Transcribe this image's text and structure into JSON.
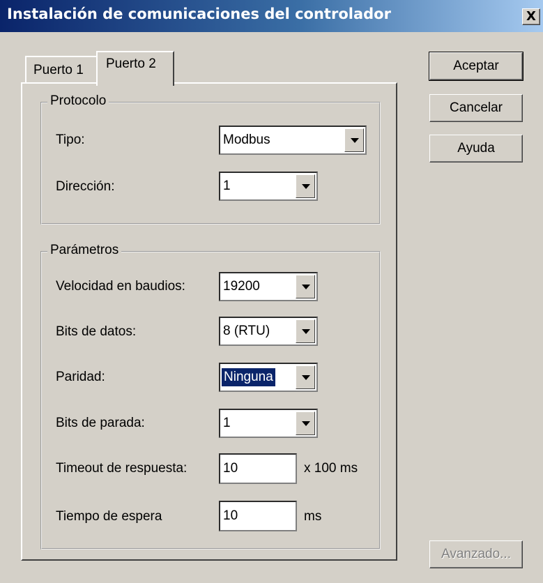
{
  "window": {
    "title": "Instalación de comunicaciones del controlador",
    "close_label": "X"
  },
  "tabs": [
    {
      "label": "Puerto 1",
      "active": false
    },
    {
      "label": "Puerto 2",
      "active": true
    }
  ],
  "protocol": {
    "legend": "Protocolo",
    "tipo": {
      "label": "Tipo:",
      "value": "Modbus"
    },
    "direccion": {
      "label": "Dirección:",
      "value": "1"
    }
  },
  "params": {
    "legend": "Parámetros",
    "baud": {
      "label": "Velocidad en baudios:",
      "value": "19200"
    },
    "data_bits": {
      "label": "Bits de datos:",
      "value": "8 (RTU)"
    },
    "parity": {
      "label": "Paridad:",
      "value": "Ninguna"
    },
    "stop_bits": {
      "label": "Bits de parada:",
      "value": "1"
    },
    "timeout": {
      "label": "Timeout de respuesta:",
      "value": "10",
      "unit": "x 100 ms"
    },
    "wait": {
      "label": "Tiempo de espera",
      "value": "10",
      "unit": "ms"
    }
  },
  "buttons": {
    "accept": "Aceptar",
    "cancel": "Cancelar",
    "help": "Ayuda",
    "advanced": "Avanzado..."
  },
  "icons": {
    "dropdown": "chevron-down-icon"
  },
  "colors": {
    "titlebar_start": "#0a246a",
    "titlebar_end": "#a6caf0",
    "dialog_bg": "#d4d0c8",
    "selection": "#0a246a"
  }
}
